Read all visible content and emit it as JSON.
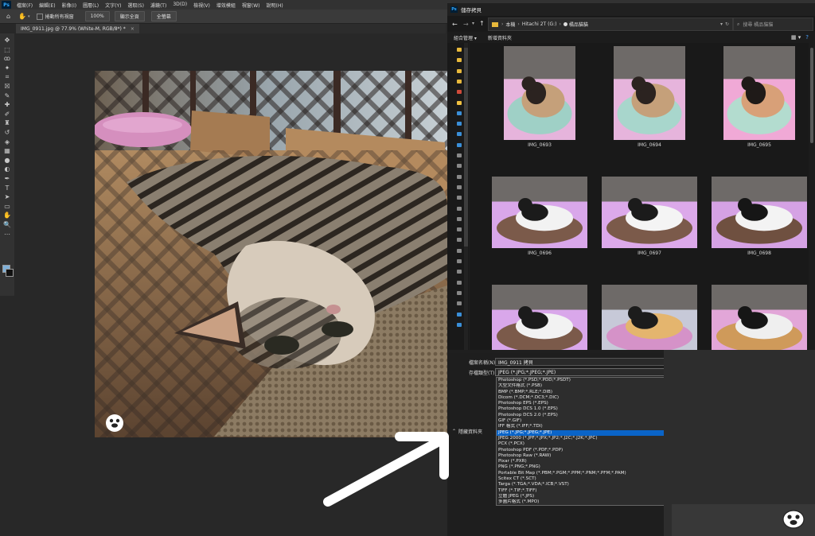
{
  "app": {
    "logo": "Ps",
    "menu": [
      "檔案(F)",
      "編輯(E)",
      "影像(I)",
      "圖層(L)",
      "文字(Y)",
      "選取(S)",
      "濾鏡(T)",
      "3D(D)",
      "檢視(V)",
      "增效模組",
      "視窗(W)",
      "說明(H)"
    ]
  },
  "options": {
    "scroll_all_windows": "捲動所有視窗",
    "zoom": "100%",
    "fit_screen": "顯示全頁",
    "fill_screen": "全螢幕"
  },
  "document": {
    "tab_title": "IMG_0911.jpg @ 77.9% (White-M, RGB/8*) *",
    "close": "×"
  },
  "toolbar": {
    "icons": [
      "move-icon",
      "marquee-icon",
      "lasso-icon",
      "magic-wand-icon",
      "crop-icon",
      "frame-icon",
      "eyedropper-icon",
      "healing-brush-icon",
      "brush-icon",
      "stamp-icon",
      "history-brush-icon",
      "eraser-icon",
      "gradient-icon",
      "blur-icon",
      "dodge-icon",
      "pen-icon",
      "type-icon",
      "path-select-icon",
      "rectangle-icon",
      "hand-icon",
      "zoom-icon",
      "more-icon"
    ],
    "glyphs": [
      "✥",
      "⬚",
      "ꝏ",
      "✦",
      "⌗",
      "☒",
      "✎",
      "✚",
      "✐",
      "♜",
      "↺",
      "◈",
      "▦",
      "●",
      "◐",
      "✒",
      "T",
      "➤",
      "▭",
      "✋",
      "🔍",
      "⋯"
    ],
    "foreground_color": "#7fb0d8",
    "background_color": "#111111"
  },
  "dialog": {
    "title": "儲存拷貝",
    "breadcrumb": [
      "本機",
      "Hitachi 2T (G:)",
      "橘品貓貓"
    ],
    "search_placeholder": "搜尋 橘品貓貓",
    "organize": "組合管理 ▾",
    "new_folder": "新增資料夾",
    "files": [
      {
        "name": "IMG_0693",
        "palette": [
          "#e6b4dc",
          "#c5a07a",
          "#2b2320",
          "#9fd0c6"
        ]
      },
      {
        "name": "IMG_0694",
        "palette": [
          "#e6b4dc",
          "#c5a07a",
          "#2b2320",
          "#a8d6cc"
        ]
      },
      {
        "name": "IMG_0695",
        "palette": [
          "#f0a9d6",
          "#d8a078",
          "#1f1a18",
          "#b3dccf"
        ]
      },
      {
        "name": "IMG_0696",
        "palette": [
          "#d9a7ea",
          "#f2f2f2",
          "#1b1b1b",
          "#7b5a4a"
        ]
      },
      {
        "name": "IMG_0697",
        "palette": [
          "#dca9ea",
          "#f4f4f4",
          "#1b1b1b",
          "#7b5a4a"
        ]
      },
      {
        "name": "IMG_0698",
        "palette": [
          "#d5a2e4",
          "#f3f3f3",
          "#161616",
          "#6f5040"
        ]
      },
      {
        "name": "",
        "palette": [
          "#d9a7ea",
          "#f2f2f2",
          "#1b1b1b",
          "#7b5a4a"
        ]
      },
      {
        "name": "",
        "palette": [
          "#c7c9d8",
          "#e4b56e",
          "#1c1c1c",
          "#d592c8"
        ]
      },
      {
        "name": "",
        "palette": [
          "#e2a6d8",
          "#efefef",
          "#161616",
          "#cf9a5a"
        ]
      }
    ],
    "filename_label": "檔案名稱(N):",
    "filename_value": "IMG_0911 拷貝",
    "filetype_label": "存檔類型(T):",
    "filetype_value": "JPEG (*.JPG;*.JPEG;*.JPE)",
    "hide_folders": "隱藏資料夾",
    "types": [
      "Photoshop (*.PSD;*.PDD;*.PSDT)",
      "大型文件格式 (*.PSB)",
      "BMP (*.BMP;*.RLE;*.DIB)",
      "Dicom (*.DCM;*.DC3;*.DIC)",
      "Photoshop EPS (*.EPS)",
      "Photoshop DCS 1.0 (*.EPS)",
      "Photoshop DCS 2.0 (*.EPS)",
      "GIF (*.GIF)",
      "IFF 格式 (*.IFF;*.TDI)",
      "JPEG (*.JPG;*.JPEG;*.JPE)",
      "JPEG 2000 (*.JPF;*.JPX;*.JP2;*.J2C;*.J2K;*.JPC)",
      "PCX (*.PCX)",
      "Photoshop PDF (*.PDF;*.PDP)",
      "Photoshop Raw (*.RAW)",
      "Pixar (*.PXR)",
      "PNG (*.PNG;*.PNG)",
      "Portable Bit Map (*.PBM;*.PGM;*.PPM;*.PNM;*.PFM;*.PAM)",
      "Scitex CT (*.SCT)",
      "Targa (*.TGA;*.VDA;*.ICB;*.VST)",
      "TIFF (*.TIF;*.TIFF)",
      "立體 JPEG (*.JPS)",
      "多圖片格式 (*.MPO)"
    ],
    "selected_type_index": 9
  }
}
